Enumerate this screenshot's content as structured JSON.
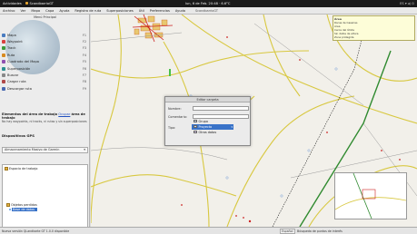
{
  "topbar": {
    "activities": "Actividades",
    "app_name": "ScandbarrioGT",
    "clock": "lun, 6 de Feb. 20:48 · 6.6°C",
    "tray": "ES ▾  ◂)  ⏻"
  },
  "menubar": {
    "items": [
      "Archivo",
      "Ver",
      "Mapa",
      "Capa",
      "Ayuda",
      "Registro de ruta",
      "Superposiciones",
      "Útil",
      "Preferencias",
      "Ayuda"
    ],
    "window_title": "ScandbarrioGT"
  },
  "left_panel": {
    "title": "Menú Principal",
    "main_menu": [
      {
        "label": "Mapa",
        "key": "F1",
        "color": "#4a7cc0"
      },
      {
        "label": "Waypoint",
        "key": "F2",
        "color": "#d84040"
      },
      {
        "label": "Track",
        "key": "F3",
        "color": "#3c9a3c"
      },
      {
        "label": "Ruta",
        "key": "F4",
        "color": "#d88a20"
      },
      {
        "label": "Cuadrado del Mapa",
        "key": "F5",
        "color": "#9050b0"
      },
      {
        "label": "Superposición",
        "key": "F6",
        "color": "#2c9090"
      },
      {
        "label": "Buscar",
        "key": "F7",
        "color": "#888888"
      },
      {
        "label": "Cargar ruta",
        "key": "F8",
        "color": "#b04848"
      },
      {
        "label": "Descargar ruta",
        "key": "F9",
        "color": "#4868b0"
      }
    ],
    "workarea_prefix": "Elementos del área de trabajo",
    "workarea_link": "Ocupar",
    "workarea_suffix": "área de trabajo",
    "workarea_hint": "No hay waypoints, ni tracks, ni rutas y sin superposiciones",
    "gps_title": "Dispositivos GPS",
    "gps_select": "Almacenamiento Masivo de Garmin",
    "tree": {
      "root": "Espacio de trabajo",
      "group": "Objetos perdidos",
      "selected": "Base de datos"
    }
  },
  "infobox": {
    "title": "Área",
    "lines": [
      "Rocas de Casarias",
      "Área",
      "Cerca del límite",
      "Sin datos de altura",
      "Zona protegida"
    ]
  },
  "dialog": {
    "title": "Editar carpeta",
    "name_label": "Nombre:",
    "comment_label": "Comentario:",
    "type_label": "Tipo:",
    "options": [
      {
        "label": "Grupo",
        "color": "#c8d8ee"
      },
      {
        "label": "Proyecto",
        "color": "#c8d8ee"
      },
      {
        "label": "Otros datos",
        "color": "#d8c8ee"
      }
    ],
    "selected_index": 1
  },
  "statusbar": {
    "ready": "Nueva versión QLandkarte GT 1.0.0 disponible",
    "lang": "Español",
    "mode": "Búsqueda de puntos de interés",
    "coords_a": "Rejilla: N40° 30.124 W003° 36.580 [N40° 30.124 W003° 36.580]",
    "coords_b": "Rejilla: N40° 30.120 W003° 36.585"
  }
}
